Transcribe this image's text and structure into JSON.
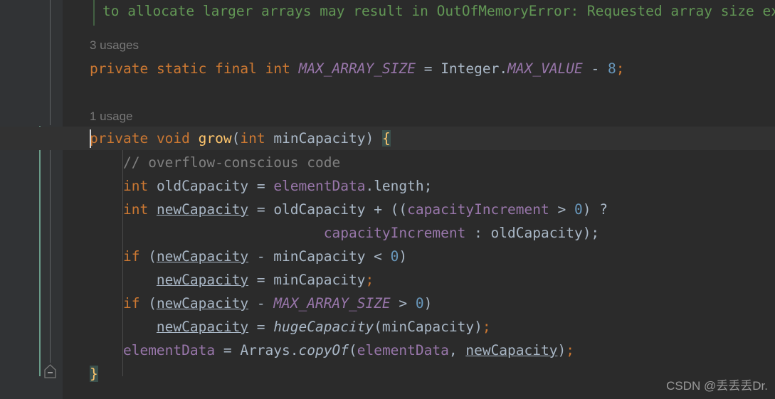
{
  "editor": {
    "background": "#2b2b2b",
    "gutter_background": "#313335",
    "current_line_background": "#323232",
    "font_size_px": 19.5,
    "line_height_px": 33
  },
  "watermark": {
    "text": "CSDN @丢丢丢Dr."
  },
  "hints": [
    {
      "id": "hint_max_array_size",
      "text": "3 usages"
    },
    {
      "id": "hint_grow",
      "text": "1 usage"
    }
  ],
  "gutter": {
    "fold_markers": [
      {
        "id": "fold-grow-open",
        "glyph": "minus",
        "state": "expanded"
      },
      {
        "id": "fold-grow-close",
        "glyph": "minus",
        "state": "expanded"
      }
    ]
  },
  "lines": [
    {
      "id": "line-javadoc-cont",
      "kind": "javadoc",
      "tokens": [
        {
          "t": "to allocate larger arrays may result in OutOfMemoryError: Requested array size exceeds VM limit",
          "c": "doc"
        }
      ]
    },
    {
      "id": "line-max-array-size",
      "kind": "code",
      "tokens": [
        {
          "t": "private",
          "c": "kw"
        },
        {
          "t": " ",
          "c": "plain"
        },
        {
          "t": "static",
          "c": "kw"
        },
        {
          "t": " ",
          "c": "plain"
        },
        {
          "t": "final",
          "c": "kw"
        },
        {
          "t": " ",
          "c": "plain"
        },
        {
          "t": "int",
          "c": "kw"
        },
        {
          "t": " ",
          "c": "plain"
        },
        {
          "t": "MAX_ARRAY_SIZE",
          "c": "staticf"
        },
        {
          "t": " = ",
          "c": "plain"
        },
        {
          "t": "Integer",
          "c": "plain"
        },
        {
          "t": ".",
          "c": "plain"
        },
        {
          "t": "MAX_VALUE",
          "c": "staticf"
        },
        {
          "t": " - ",
          "c": "plain"
        },
        {
          "t": "8",
          "c": "num"
        },
        {
          "t": ";",
          "c": "semi"
        }
      ]
    },
    {
      "id": "line-grow-signature",
      "kind": "code",
      "current": true,
      "tokens": [
        {
          "t": "private",
          "c": "kw"
        },
        {
          "t": " ",
          "c": "plain"
        },
        {
          "t": "void",
          "c": "kw"
        },
        {
          "t": " ",
          "c": "plain"
        },
        {
          "t": "grow",
          "c": "method"
        },
        {
          "t": "(",
          "c": "plain"
        },
        {
          "t": "int",
          "c": "kw"
        },
        {
          "t": " minCapacity",
          "c": "plain"
        },
        {
          "t": ") ",
          "c": "plain"
        },
        {
          "t": "{",
          "c": "brace"
        }
      ]
    },
    {
      "id": "line-comment-overflow",
      "kind": "code",
      "tokens": [
        {
          "t": "    ",
          "c": "plain"
        },
        {
          "t": "// overflow-conscious code",
          "c": "comment"
        }
      ]
    },
    {
      "id": "line-old-capacity",
      "kind": "code",
      "tokens": [
        {
          "t": "    ",
          "c": "plain"
        },
        {
          "t": "int",
          "c": "kw"
        },
        {
          "t": " oldCapacity = ",
          "c": "plain"
        },
        {
          "t": "elementData",
          "c": "field"
        },
        {
          "t": ".length;",
          "c": "plain"
        }
      ]
    },
    {
      "id": "line-new-capacity-assign",
      "kind": "code",
      "tokens": [
        {
          "t": "    ",
          "c": "plain"
        },
        {
          "t": "int",
          "c": "kw"
        },
        {
          "t": " ",
          "c": "plain"
        },
        {
          "t": "newCapacity",
          "c": "plain under"
        },
        {
          "t": " = oldCapacity + ((",
          "c": "plain"
        },
        {
          "t": "capacityIncrement",
          "c": "field"
        },
        {
          "t": " > ",
          "c": "plain"
        },
        {
          "t": "0",
          "c": "num"
        },
        {
          "t": ") ?",
          "c": "plain"
        }
      ]
    },
    {
      "id": "line-ternary-cont",
      "kind": "code",
      "tokens": [
        {
          "t": "                            ",
          "c": "plain"
        },
        {
          "t": "capacityIncrement",
          "c": "field"
        },
        {
          "t": " : oldCapacity);",
          "c": "plain"
        }
      ]
    },
    {
      "id": "line-if-mincapacity",
      "kind": "code",
      "tokens": [
        {
          "t": "    ",
          "c": "plain"
        },
        {
          "t": "if",
          "c": "kw"
        },
        {
          "t": " (",
          "c": "plain"
        },
        {
          "t": "newCapacity",
          "c": "plain under"
        },
        {
          "t": " - minCapacity < ",
          "c": "plain"
        },
        {
          "t": "0",
          "c": "num"
        },
        {
          "t": ")",
          "c": "plain"
        }
      ]
    },
    {
      "id": "line-assign-mincapacity",
      "kind": "code",
      "tokens": [
        {
          "t": "        ",
          "c": "plain"
        },
        {
          "t": "newCapacity",
          "c": "plain under"
        },
        {
          "t": " = minCapacity",
          "c": "plain"
        },
        {
          "t": ";",
          "c": "semi"
        }
      ]
    },
    {
      "id": "line-if-maxarraysize",
      "kind": "code",
      "tokens": [
        {
          "t": "    ",
          "c": "plain"
        },
        {
          "t": "if",
          "c": "kw"
        },
        {
          "t": " (",
          "c": "plain"
        },
        {
          "t": "newCapacity",
          "c": "plain under"
        },
        {
          "t": " - ",
          "c": "plain"
        },
        {
          "t": "MAX_ARRAY_SIZE",
          "c": "staticf"
        },
        {
          "t": " > ",
          "c": "plain"
        },
        {
          "t": "0",
          "c": "num"
        },
        {
          "t": ")",
          "c": "plain"
        }
      ]
    },
    {
      "id": "line-huge-capacity",
      "kind": "code",
      "tokens": [
        {
          "t": "        ",
          "c": "plain"
        },
        {
          "t": "newCapacity",
          "c": "plain under"
        },
        {
          "t": " = ",
          "c": "plain"
        },
        {
          "t": "hugeCapacity",
          "c": "mcallitl"
        },
        {
          "t": "(minCapacity)",
          "c": "plain"
        },
        {
          "t": ";",
          "c": "semi"
        }
      ]
    },
    {
      "id": "line-arrays-copyof",
      "kind": "code",
      "tokens": [
        {
          "t": "    ",
          "c": "plain"
        },
        {
          "t": "elementData",
          "c": "field"
        },
        {
          "t": " = Arrays.",
          "c": "plain"
        },
        {
          "t": "copyOf",
          "c": "mcallitl"
        },
        {
          "t": "(",
          "c": "plain"
        },
        {
          "t": "elementData",
          "c": "field"
        },
        {
          "t": ", ",
          "c": "plain"
        },
        {
          "t": "newCapacity",
          "c": "plain under"
        },
        {
          "t": ")",
          "c": "plain"
        },
        {
          "t": ";",
          "c": "semi"
        }
      ]
    },
    {
      "id": "line-close-brace",
      "kind": "code",
      "tokens": [
        {
          "t": "}",
          "c": "brace"
        }
      ]
    }
  ]
}
